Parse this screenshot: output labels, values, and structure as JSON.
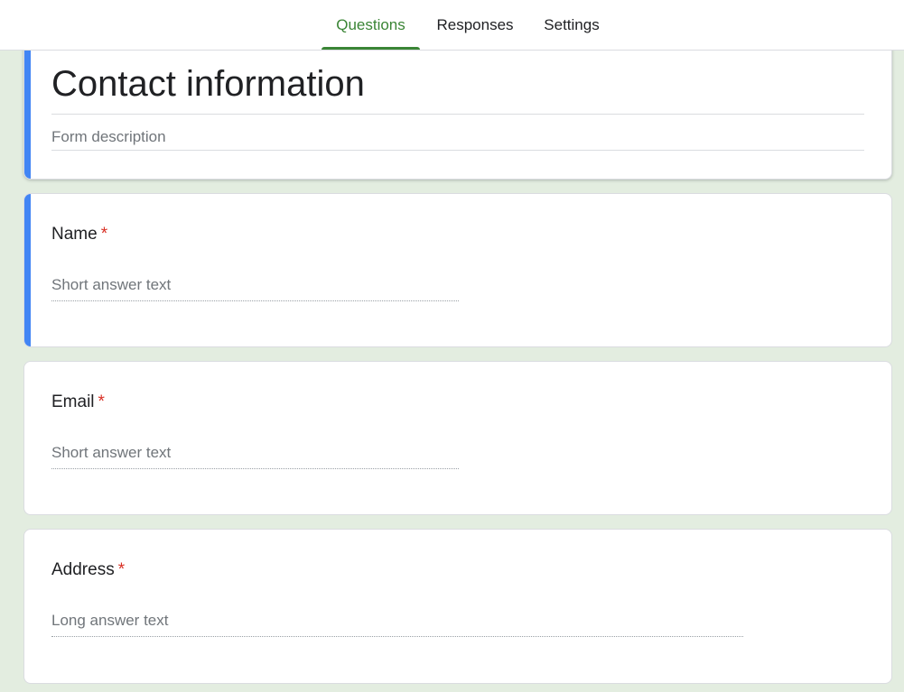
{
  "tabs": [
    {
      "label": "Questions",
      "active": true
    },
    {
      "label": "Responses",
      "active": false
    },
    {
      "label": "Settings",
      "active": false
    }
  ],
  "form": {
    "title": "Contact information",
    "description_placeholder": "Form description"
  },
  "questions": [
    {
      "label": "Name",
      "required_marker": "*",
      "answer_placeholder": "Short answer text",
      "type": "short"
    },
    {
      "label": "Email",
      "required_marker": "*",
      "answer_placeholder": "Short answer text",
      "type": "short"
    },
    {
      "label": "Address",
      "required_marker": "*",
      "answer_placeholder": "Long answer text",
      "type": "long"
    }
  ],
  "colors": {
    "accent_green": "#3a8535",
    "focus_blue": "#4285f4",
    "required_red": "#d93025",
    "background": "#e3ede0"
  }
}
